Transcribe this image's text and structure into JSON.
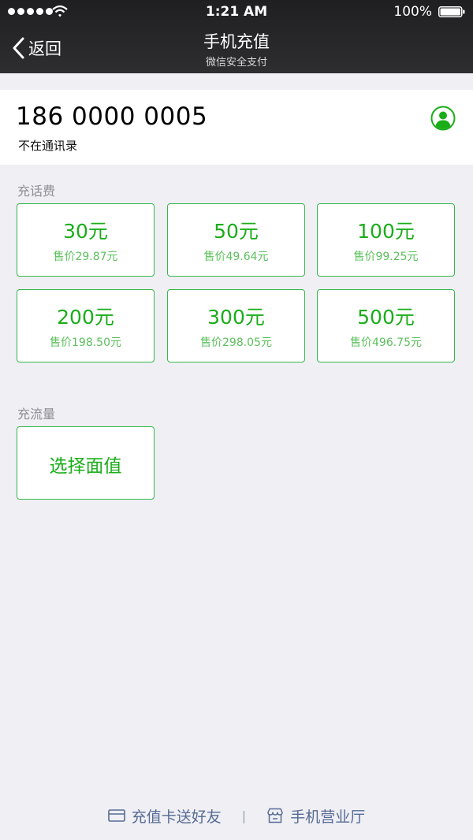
{
  "status_bar": {
    "time": "1:21 AM",
    "battery_text": "100%",
    "signal_icon": "signal-dots-icon",
    "wifi_icon": "wifi-icon",
    "battery_icon": "battery-icon"
  },
  "nav": {
    "back_label": "返回",
    "back_icon": "chevron-left-icon",
    "title": "手机充值",
    "subtitle": "微信安全支付"
  },
  "phone": {
    "number": "186 0000 0005",
    "note": "不在通讯录",
    "contacts_icon": "person-circle-icon"
  },
  "call_credit": {
    "label": "充话费",
    "options": [
      {
        "amount": "30元",
        "price": "售价29.87元"
      },
      {
        "amount": "50元",
        "price": "售价49.64元"
      },
      {
        "amount": "100元",
        "price": "售价99.25元"
      },
      {
        "amount": "200元",
        "price": "售价198.50元"
      },
      {
        "amount": "300元",
        "price": "售价298.05元"
      },
      {
        "amount": "500元",
        "price": "售价496.75元"
      }
    ]
  },
  "data_plan": {
    "label": "充流量",
    "select_label": "选择面值"
  },
  "footer": {
    "gift_card_label": "充值卡送好友",
    "gift_card_icon": "card-icon",
    "separator": "|",
    "store_label": "手机营业厅",
    "store_icon": "store-icon"
  },
  "colors": {
    "accent_green": "#1aad19",
    "tile_border": "#35b84a",
    "link_blue": "#576b95",
    "nav_bg": "#2b2b2d",
    "page_bg": "#efeff4"
  }
}
